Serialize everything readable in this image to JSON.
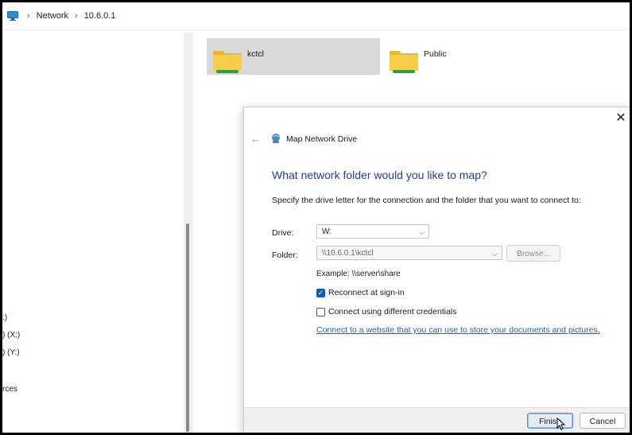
{
  "breadcrumb": {
    "items": [
      "Network",
      "10.6.0.1"
    ]
  },
  "nav": {
    "items": [
      ":)",
      ") (X:)",
      ") (Y:)",
      "rces"
    ]
  },
  "folders": [
    {
      "label": "kctcl",
      "selected": true
    },
    {
      "label": "Public",
      "selected": false
    }
  ],
  "dialog": {
    "title": "Map Network Drive",
    "heading": "What network folder would you like to map?",
    "instruction": "Specify the drive letter for the connection and the folder that you want to connect to:",
    "drive_label": "Drive:",
    "drive_value": "W:",
    "folder_label": "Folder:",
    "folder_value": "\\\\10.6.0.1\\kctcl",
    "browse_label": "Browse...",
    "example": "Example: \\\\server\\share",
    "reconnect_label": "Reconnect at sign-in",
    "reconnect_checked": true,
    "credentials_label": "Connect using different credentials",
    "credentials_checked": false,
    "link_text": "Connect to a website that you can use to store your documents and pictures",
    "finish_label": "Finish",
    "cancel_label": "Cancel"
  },
  "colors": {
    "heading": "#1f3f8f",
    "link": "#1f5fb5",
    "checkbox": "#0f5fb8",
    "folder": "#f5c842"
  }
}
